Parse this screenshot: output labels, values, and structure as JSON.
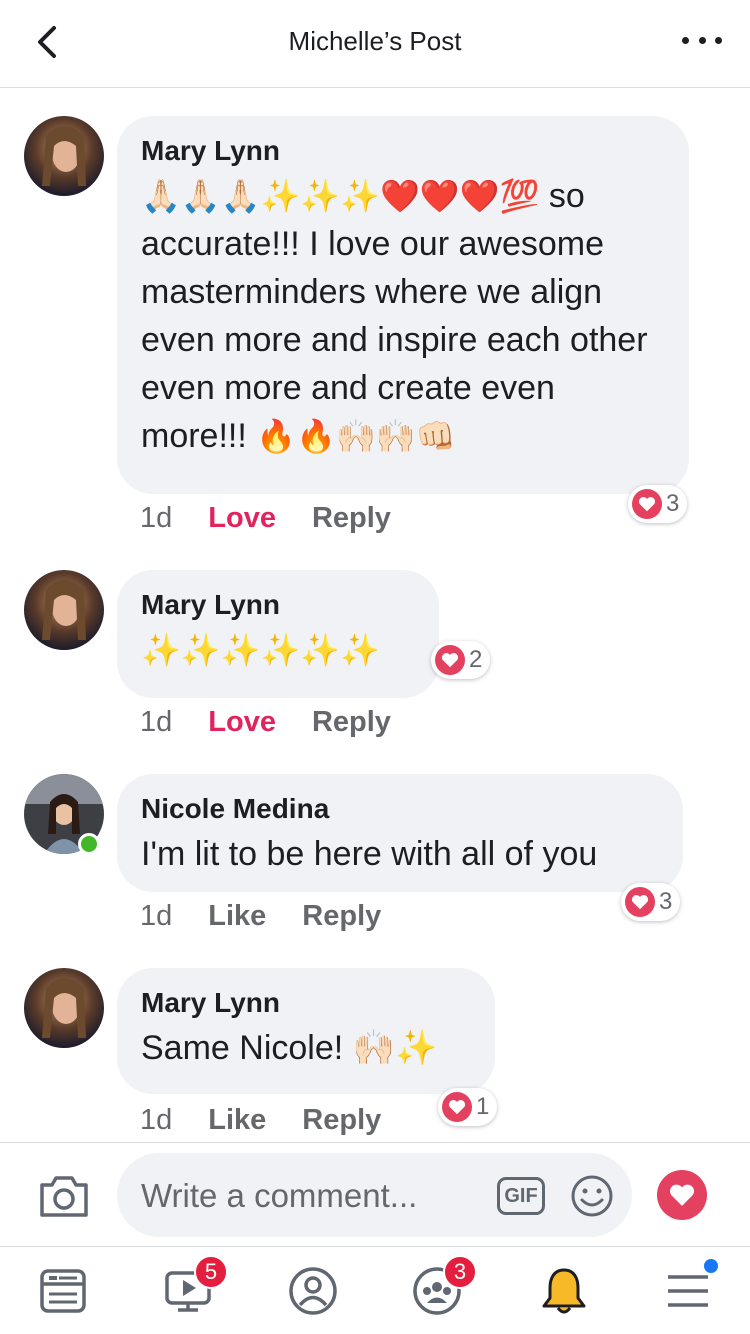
{
  "header": {
    "title": "Michelle’s Post",
    "back_icon": "chevron-left-icon",
    "more_icon": "more-horizontal-icon"
  },
  "comments": [
    {
      "author": "Mary Lynn",
      "emoji_prefix": "🙏🏻🙏🏻🙏🏻✨✨✨❤️❤️❤️💯",
      "text": "so accurate!!! I love our awesome masterminders where we align even more and inspire each other even more and create even more!!!",
      "emoji_suffix": "🔥🔥🙌🏻🙌🏻👊🏻",
      "time": "1d",
      "reaction_action": "Love",
      "reply": "Reply",
      "reaction_count": "3"
    },
    {
      "author": "Mary Lynn",
      "text": "✨✨✨✨✨✨",
      "time": "1d",
      "reaction_action": "Love",
      "reply": "Reply",
      "reaction_count": "2"
    },
    {
      "author": "Nicole Medina",
      "text": "I'm lit to be here with all of you",
      "time": "1d",
      "reaction_action": "Like",
      "reply": "Reply",
      "reaction_count": "3",
      "online": true
    },
    {
      "author": "Mary Lynn",
      "text": "Same Nicole! 🙌🏻✨",
      "time": "1d",
      "reaction_action": "Like",
      "reply": "Reply",
      "reaction_count": "1"
    }
  ],
  "composer": {
    "placeholder": "Write a comment...",
    "gif_label": "GIF"
  },
  "tabbar": {
    "tabs": [
      {
        "icon": "news-feed-icon"
      },
      {
        "icon": "watch-icon",
        "badge": "5"
      },
      {
        "icon": "profile-icon"
      },
      {
        "icon": "groups-icon",
        "badge": "3"
      },
      {
        "icon": "notifications-bell-icon"
      },
      {
        "icon": "menu-icon"
      }
    ]
  },
  "colors": {
    "accent_love": "#e0245e",
    "bubble": "#f0f2f5",
    "badge": "#e41e3f",
    "online": "#42b72a"
  }
}
